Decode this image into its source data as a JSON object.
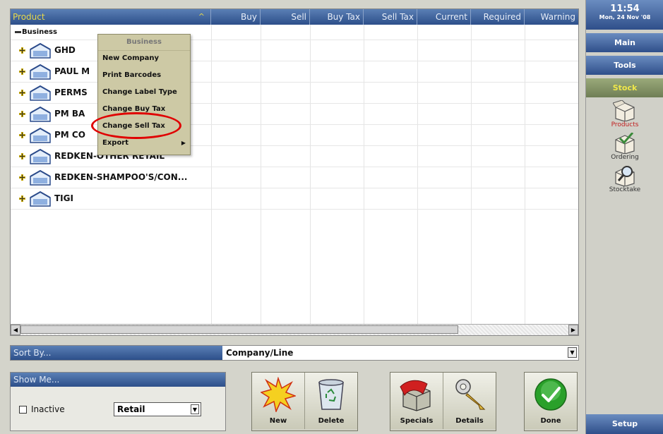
{
  "grid": {
    "columns": [
      {
        "key": "product",
        "label": "Product"
      },
      {
        "key": "buy",
        "label": "Buy"
      },
      {
        "key": "sell",
        "label": "Sell"
      },
      {
        "key": "buy_tax",
        "label": "Buy Tax"
      },
      {
        "key": "sell_tax",
        "label": "Sell Tax"
      },
      {
        "key": "current",
        "label": "Current"
      },
      {
        "key": "required",
        "label": "Required"
      },
      {
        "key": "warning",
        "label": "Warning"
      }
    ],
    "group_label": "Business",
    "rows": [
      {
        "label": "GHD"
      },
      {
        "label": "PAUL M"
      },
      {
        "label": "PERMS"
      },
      {
        "label": "PM BA"
      },
      {
        "label": "PM CO"
      },
      {
        "label": "REDKEN-OTHER RETAIL"
      },
      {
        "label": "REDKEN-SHAMPOO'S/CON..."
      },
      {
        "label": "TIGI"
      }
    ]
  },
  "context_menu": {
    "title": "Business",
    "items": [
      {
        "label": "New Company"
      },
      {
        "label": "Print Barcodes"
      },
      {
        "label": "Change Label Type"
      },
      {
        "label": "Change Buy Tax"
      },
      {
        "label": "Change Sell Tax"
      },
      {
        "label": "Export"
      }
    ]
  },
  "sort": {
    "label": "Sort By...",
    "value": "Company/Line"
  },
  "show_me": {
    "title": "Show Me...",
    "inactive_label": "Inactive",
    "inactive_checked": false,
    "select_value": "Retail"
  },
  "actions": {
    "new": "New",
    "delete": "Delete",
    "specials": "Specials",
    "details": "Details",
    "done": "Done"
  },
  "sidebar": {
    "time": "11:54",
    "date": "Mon, 24 Nov '08",
    "main": "Main",
    "tools": "Tools",
    "stock": "Stock",
    "nav": [
      {
        "label": "Products",
        "icon": "box-icon",
        "active": true
      },
      {
        "label": "Ordering",
        "icon": "check-box-icon",
        "active": false
      },
      {
        "label": "Stocktake",
        "icon": "magnifier-box-icon",
        "active": false
      }
    ],
    "setup": "Setup"
  },
  "colors": {
    "accent_blue": "#2d4f8a",
    "header_text_yellow": "#e8d84a",
    "highlight_red": "#e00000",
    "menu_bg": "#cdc9a5"
  }
}
